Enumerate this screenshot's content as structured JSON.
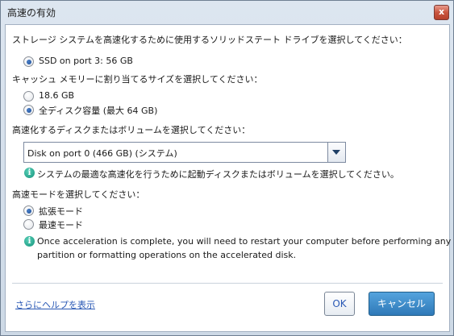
{
  "window": {
    "title": "高速の有効",
    "close_label": "x"
  },
  "drive_section": {
    "heading": "ストレージ システムを高速化するために使用するソリッドステート ドライブを選択してください：",
    "options": [
      {
        "label": "SSD on port 3: 56 GB",
        "checked": true
      }
    ]
  },
  "cache_section": {
    "heading": "キャッシュ メモリーに割り当てるサイズを選択してください：",
    "options": [
      {
        "label": "18.6 GB",
        "checked": false
      },
      {
        "label": "全ディスク容量 (最大 64 GB)",
        "checked": true
      }
    ]
  },
  "volume_section": {
    "heading": "高速化するディスクまたはボリュームを選択してください：",
    "select_value": "Disk on port 0 (466 GB) (システム)",
    "info_text": "システムの最適な高速化を行うために起動ディスクまたはボリュームを選択してください。"
  },
  "mode_section": {
    "heading": "高速モードを選択してください：",
    "options": [
      {
        "label": "拡張モード",
        "checked": true
      },
      {
        "label": "最速モード",
        "checked": false
      }
    ],
    "info_line1": "Once acceleration is complete, you will need to restart your computer before performing any",
    "info_line2": "partition or formatting operations on the accelerated disk."
  },
  "footer": {
    "help_link": "さらにヘルプを表示",
    "ok_label": "OK",
    "cancel_label": "キャンセル"
  },
  "colors": {
    "accent": "#2f79b8",
    "link": "#2a59b5",
    "info": "#15927a"
  },
  "icons": [
    "close-icon",
    "info-icon",
    "chevron-down-icon"
  ]
}
